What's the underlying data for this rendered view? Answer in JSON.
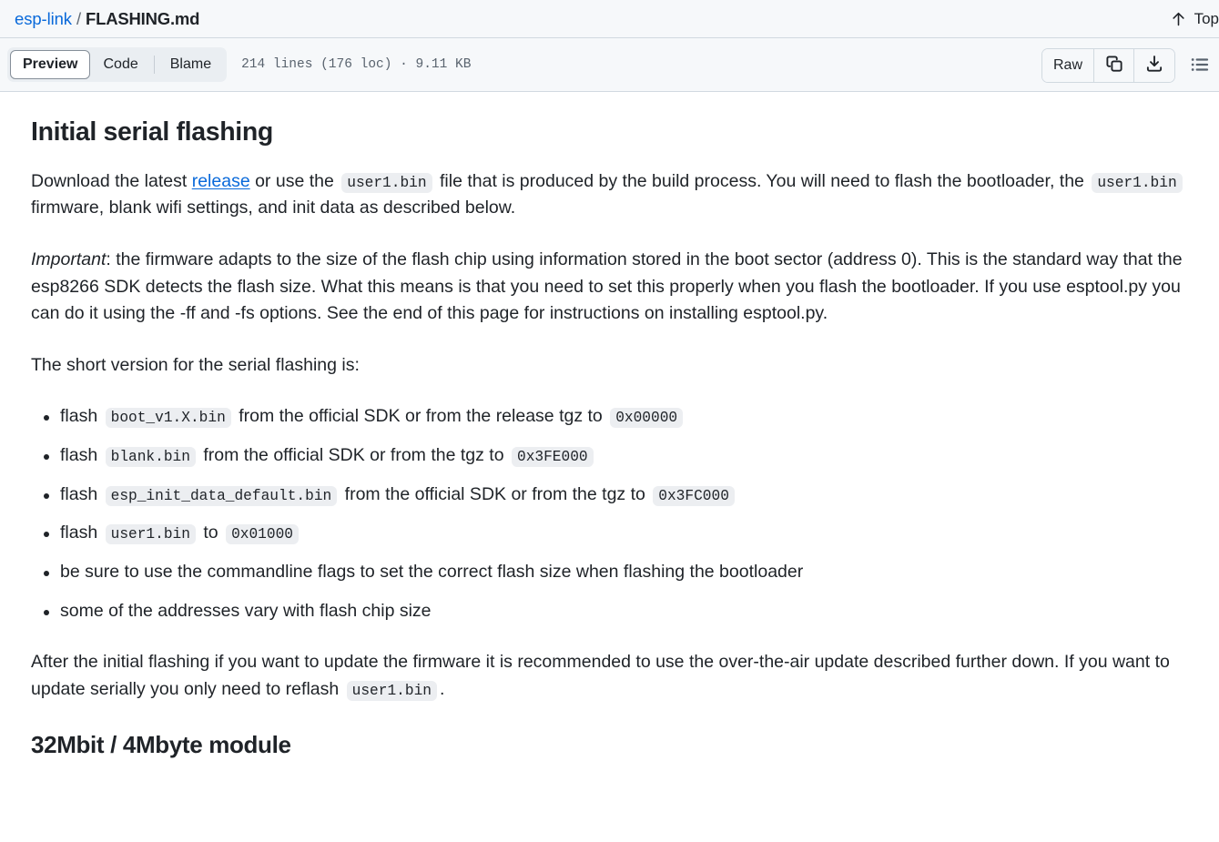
{
  "header": {
    "repo": "esp-link",
    "separator": "/",
    "filename": "FLASHING.md",
    "top_link_label": "Top",
    "top_icon": "arrow-up-icon"
  },
  "toolbar": {
    "tabs": [
      {
        "label": "Preview",
        "selected": true
      },
      {
        "label": "Code",
        "selected": false
      },
      {
        "label": "Blame",
        "selected": false
      }
    ],
    "file_meta": "214 lines (176 loc) · 9.11 KB",
    "raw_label": "Raw",
    "copy_icon": "copy-icon",
    "download_icon": "download-icon",
    "outline_icon": "unordered-list-icon"
  },
  "colors": {
    "link": "#0969da",
    "header_bg": "#f6f8fa",
    "border": "#d1d9e0",
    "code_bg": "#eceef1",
    "text": "#1f2328",
    "muted": "#59636e"
  },
  "content": {
    "h1": "Initial serial flashing",
    "p1": {
      "a": "Download the latest ",
      "link": "release",
      "b": " or use the ",
      "code1": "user1.bin",
      "c": " file that is produced by the build process. You will need to flash the bootloader, the ",
      "code2": "user1.bin",
      "d": " firmware, blank wifi settings, and init data as described below."
    },
    "p2": {
      "em": "Important",
      "text": ": the firmware adapts to the size of the flash chip using information stored in the boot sector (address 0). This is the standard way that the esp8266 SDK detects the flash size. What this means is that you need to set this properly when you flash the bootloader. If you use esptool.py you can do it using the -ff and -fs options. See the end of this page for instructions on installing esptool.py."
    },
    "p3": "The short version for the serial flashing is:",
    "bullets": [
      {
        "a": "flash ",
        "code1": "boot_v1.X.bin",
        "b": " from the official SDK or from the release tgz to ",
        "code2": "0x00000",
        "c": ""
      },
      {
        "a": "flash ",
        "code1": "blank.bin",
        "b": " from the official SDK or from the tgz to ",
        "code2": "0x3FE000",
        "c": ""
      },
      {
        "a": "flash ",
        "code1": "esp_init_data_default.bin",
        "b": " from the official SDK or from the tgz to ",
        "code2": "0x3FC000",
        "c": ""
      },
      {
        "a": "flash ",
        "code1": "user1.bin",
        "b": " to ",
        "code2": "0x01000",
        "c": ""
      },
      {
        "a": "be sure to use the commandline flags to set the correct flash size when flashing the bootloader",
        "code1": "",
        "b": "",
        "code2": "",
        "c": ""
      },
      {
        "a": "some of the addresses vary with flash chip size",
        "code1": "",
        "b": "",
        "code2": "",
        "c": ""
      }
    ],
    "p4": {
      "a": "After the initial flashing if you want to update the firmware it is recommended to use the over-the-air update described further down. If you want to update serially you only need to reflash ",
      "code1": "user1.bin",
      "b": "."
    },
    "h2": "32Mbit / 4Mbyte module"
  }
}
